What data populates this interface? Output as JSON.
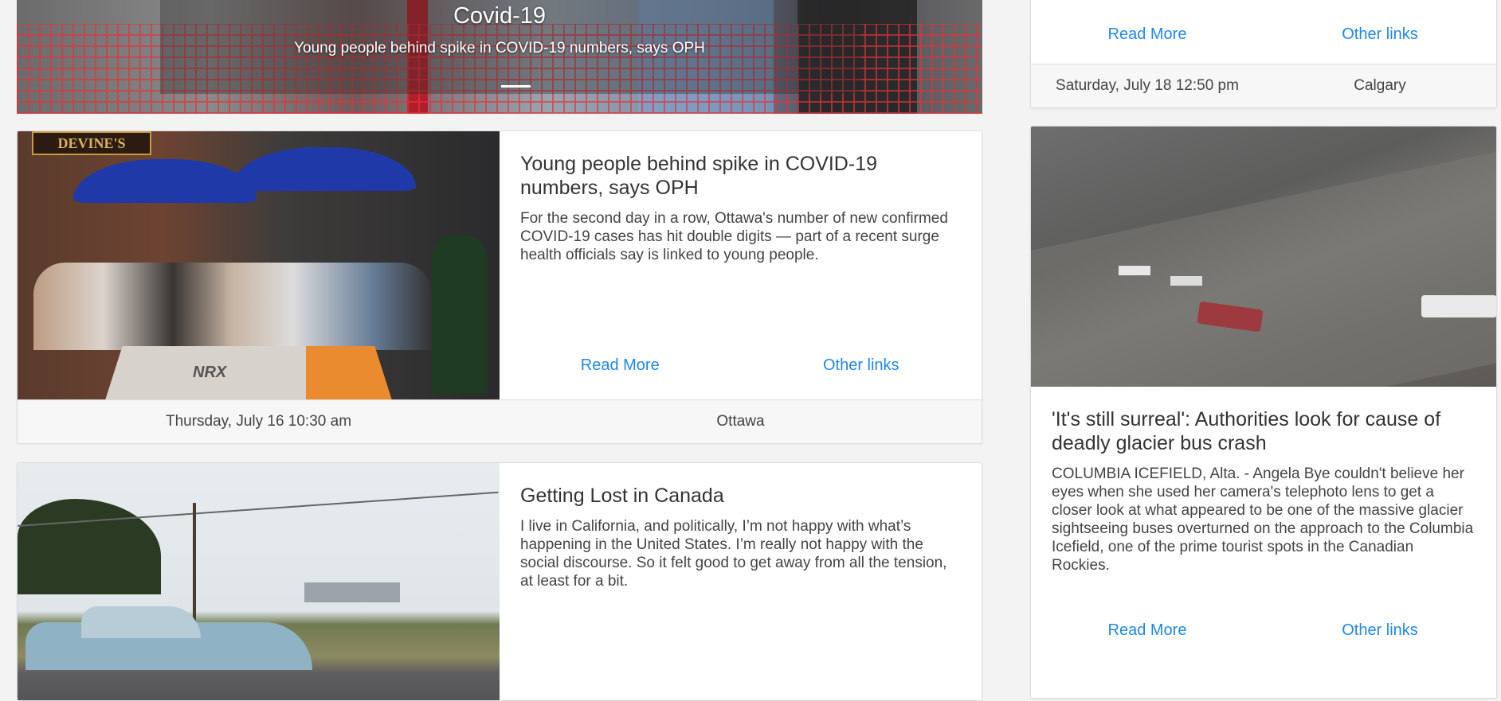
{
  "hero": {
    "title": "Covid-19",
    "subtitle": "Young people behind spike in COVID-19 numbers, says OPH"
  },
  "articles": [
    {
      "title": "Young people behind spike in COVID-19 numbers, says OPH",
      "summary": "For the second day in a row, Ottawa's number of new confirmed COVID-19 cases has hit double digits — part of a recent surge health officials say is linked to young people.",
      "read_more": "Read More",
      "other_links": "Other links",
      "date": "Thursday, July 16 10:30 am",
      "location": "Ottawa",
      "image": {
        "sign_text": "DEVINE'S",
        "barrier_text": "NRX"
      }
    },
    {
      "title": "Getting Lost in Canada",
      "summary": "I live in California, and politically, I’m not happy with what’s happening in the United States. I’m really not happy with the social discourse. So it felt good to get away from all the tension, at least for a bit."
    }
  ],
  "sidebar": {
    "top_card": {
      "read_more": "Read More",
      "other_links": "Other links",
      "date": "Saturday, July 18 12:50 pm",
      "location": "Calgary"
    },
    "feature": {
      "title": "'It's still surreal': Authorities look for cause of deadly glacier bus crash",
      "summary": "COLUMBIA ICEFIELD, Alta. - Angela Bye couldn't believe her eyes when she used her camera's telephoto lens to get a closer look at what appeared to be one of the massive glacier sightseeing buses overturned on the approach to the Columbia Icefield, one of the prime tourist spots in the Canadian Rockies.",
      "read_more": "Read More",
      "other_links": "Other links"
    }
  },
  "colors": {
    "link": "#1e88e5",
    "background": "#f3f3f3"
  }
}
